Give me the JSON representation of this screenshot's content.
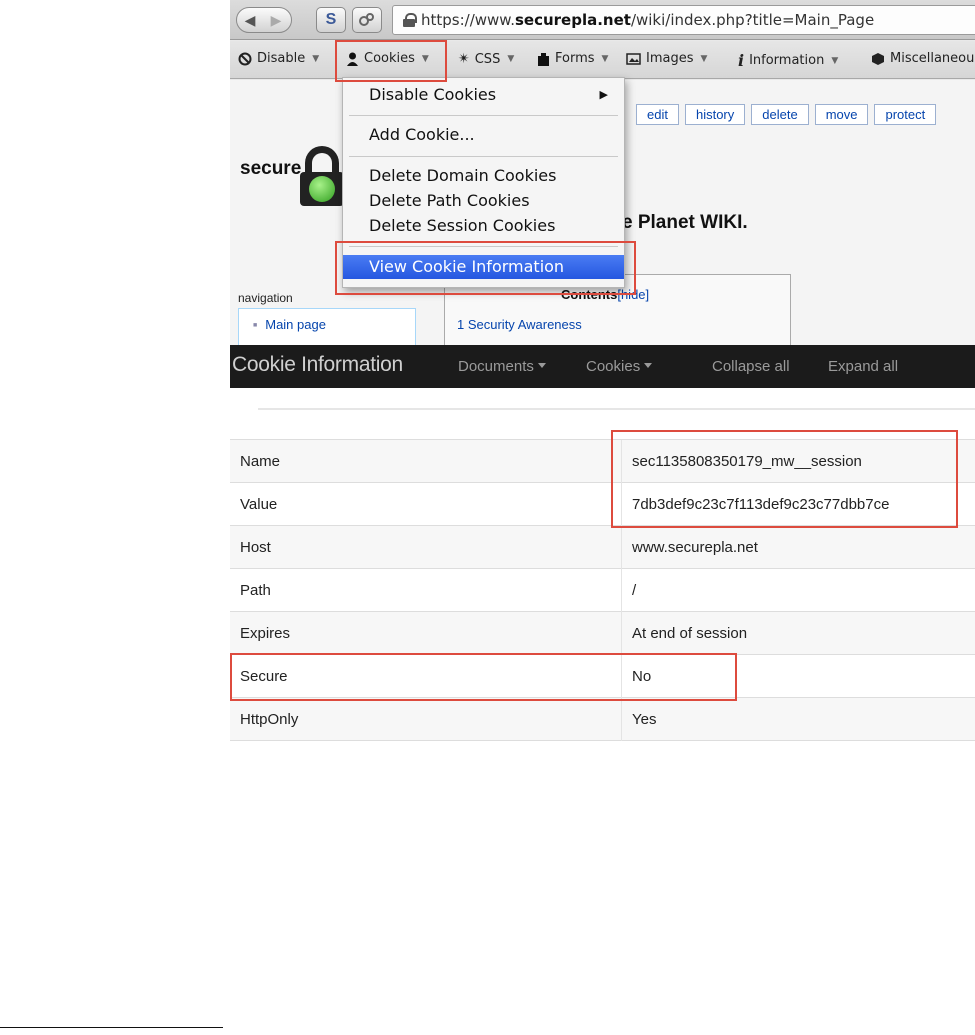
{
  "browser": {
    "url_prefix": "https://www.",
    "url_domain": "securepla.net",
    "url_path": "/wiki/index.php?title=Main_Page",
    "back_glyph": "◀",
    "forward_glyph": "▶",
    "s_glyph": "S"
  },
  "toolbar": {
    "items": [
      {
        "icon": "disable-icon",
        "label": "Disable"
      },
      {
        "icon": "cookie-person-icon",
        "label": "Cookies"
      },
      {
        "icon": "css-wand-icon",
        "label": "CSS"
      },
      {
        "icon": "forms-icon",
        "label": "Forms"
      },
      {
        "icon": "images-icon",
        "label": "Images"
      },
      {
        "icon": "info-icon",
        "label": "Information"
      },
      {
        "icon": "misc-icon",
        "label": "Miscellaneous"
      }
    ]
  },
  "wiki": {
    "tabs": [
      "edit",
      "history",
      "delete",
      "move",
      "protect"
    ],
    "logo_text": "secure",
    "heading_fragment": "e Planet WIKI.",
    "nav_label": "navigation",
    "nav_main": "Main page",
    "toc_title": "Contents",
    "toc_hide": "[hide]",
    "toc_item": "1 Security Awareness"
  },
  "cookie_menu": {
    "items": [
      {
        "label": "Disable Cookies",
        "has_submenu": true
      },
      {
        "label": "Add Cookie..."
      },
      {
        "label": "Delete Domain Cookies"
      },
      {
        "label": "Delete Path Cookies"
      },
      {
        "label": "Delete Session Cookies"
      },
      {
        "label": "View Cookie Information",
        "selected": true
      }
    ]
  },
  "cookie_info": {
    "title": "Cookie Information",
    "nav": [
      "Documents",
      "Cookies",
      "Collapse all",
      "Expand all"
    ],
    "rows": [
      {
        "key": "Name",
        "value": "sec1135808350179_mw__session"
      },
      {
        "key": "Value",
        "value": "7db3def9c23c7f113def9c23c77dbb7ce"
      },
      {
        "key": "Host",
        "value": "www.securepla.net"
      },
      {
        "key": "Path",
        "value": "/"
      },
      {
        "key": "Expires",
        "value": "At end of session"
      },
      {
        "key": "Secure",
        "value": "No"
      },
      {
        "key": "HttpOnly",
        "value": "Yes"
      }
    ]
  },
  "colors": {
    "highlight_box": "#dd4b3e",
    "menu_selection": "#2557e0",
    "nav_bar": "#1b1b1b"
  }
}
